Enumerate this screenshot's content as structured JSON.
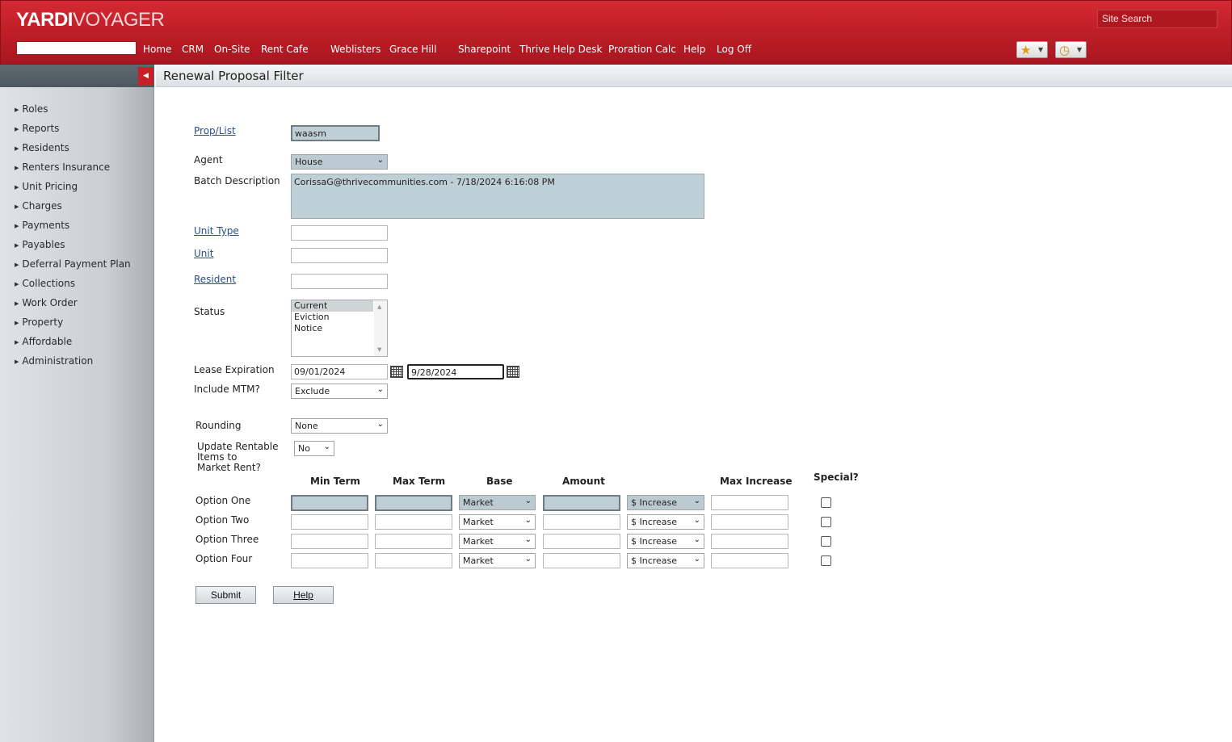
{
  "app": {
    "logo_yardi": "YARDI",
    "logo_voyager": "VOYAGER"
  },
  "header": {
    "search_value": "",
    "nav": [
      {
        "label": "Home"
      },
      {
        "label": "CRM"
      },
      {
        "label": "On-Site"
      },
      {
        "label": "Rent Cafe"
      },
      {
        "label": "Weblisters"
      },
      {
        "label": "Grace Hill"
      },
      {
        "label": "Sharepoint"
      },
      {
        "label": "Thrive Help Desk"
      },
      {
        "label": "Proration Calc"
      },
      {
        "label": "Help"
      },
      {
        "label": "Log Off"
      }
    ],
    "site_search": "Site Search",
    "icons": {
      "favorites": "star-icon",
      "history": "clock-icon",
      "dropdown": "caret-down-icon",
      "collapse": "triangle-left-icon",
      "calendar": "calendar-icon"
    },
    "glyphs": {
      "star": "★",
      "clock": "◷",
      "caret": "▼",
      "collapse": "◀",
      "bullet": "▶",
      "chevron": "⌄",
      "up": "▲",
      "down": "▼"
    }
  },
  "sidebar": {
    "items": [
      {
        "label": "Roles"
      },
      {
        "label": "Reports"
      },
      {
        "label": "Residents"
      },
      {
        "label": "Renters Insurance"
      },
      {
        "label": "Unit Pricing"
      },
      {
        "label": "Charges"
      },
      {
        "label": "Payments"
      },
      {
        "label": "Payables"
      },
      {
        "label": "Deferral Payment Plan"
      },
      {
        "label": "Collections"
      },
      {
        "label": "Work Order"
      },
      {
        "label": "Property"
      },
      {
        "label": "Affordable"
      },
      {
        "label": "Administration"
      }
    ]
  },
  "page": {
    "title": "Renewal Proposal Filter"
  },
  "form": {
    "prop_list": {
      "label": "Prop/List",
      "value": "waasm"
    },
    "agent": {
      "label": "Agent",
      "value": "House"
    },
    "batch_description": {
      "label": "Batch Description",
      "value": "CorissaG@thrivecommunities.com - 7/18/2024 6:16:08 PM"
    },
    "unit_type": {
      "label": "Unit Type",
      "value": ""
    },
    "unit": {
      "label": "Unit",
      "value": ""
    },
    "resident": {
      "label": "Resident",
      "value": ""
    },
    "status": {
      "label": "Status",
      "options": [
        "Current",
        "Eviction",
        "Notice"
      ],
      "selected": "Current"
    },
    "lease_expiration": {
      "label": "Lease Expiration",
      "from": "09/01/2024",
      "to": "9/28/2024"
    },
    "include_mtm": {
      "label": "Include MTM?",
      "value": "Exclude"
    },
    "rounding": {
      "label": "Rounding",
      "value": "None"
    },
    "update_rentable": {
      "label_line1": "Update Rentable",
      "label_line2": "Items to",
      "label_line3": "Market Rent?",
      "value": "No"
    },
    "columns": {
      "min_term": "Min Term",
      "max_term": "Max Term",
      "base": "Base",
      "amount": "Amount",
      "max_increase": "Max Increase",
      "special": "Special?"
    },
    "options": [
      {
        "label": "Option One",
        "min_term": "",
        "max_term": "",
        "base": "Market",
        "amount": "",
        "increase_type": "$ Increase",
        "max_increase": "",
        "special": false
      },
      {
        "label": "Option Two",
        "min_term": "",
        "max_term": "",
        "base": "Market",
        "amount": "",
        "increase_type": "$ Increase",
        "max_increase": "",
        "special": false
      },
      {
        "label": "Option Three",
        "min_term": "",
        "max_term": "",
        "base": "Market",
        "amount": "",
        "increase_type": "$ Increase",
        "max_increase": "",
        "special": false
      },
      {
        "label": "Option Four",
        "min_term": "",
        "max_term": "",
        "base": "Market",
        "amount": "",
        "increase_type": "$ Increase",
        "max_increase": "",
        "special": false
      }
    ],
    "submit_label": "Submit",
    "help_label": "Help"
  },
  "colors": {
    "brand_red": "#c11f28",
    "field_blue": "#bfcfd6",
    "link": "#2a4f86"
  }
}
